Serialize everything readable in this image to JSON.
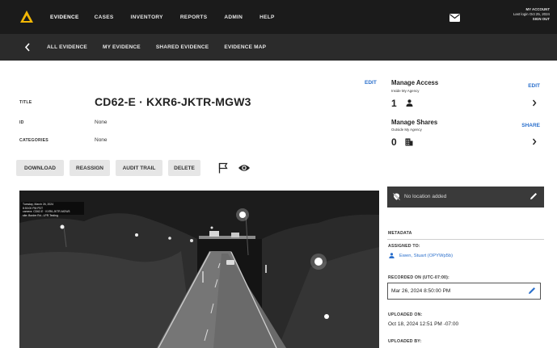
{
  "topnav": {
    "items": [
      "EVIDENCE",
      "CASES",
      "INVENTORY",
      "REPORTS",
      "ADMIN",
      "HELP"
    ],
    "active_index": 0,
    "account": {
      "title": "MY ACCOUNT",
      "last_login": "Last login Oct 25, 2024",
      "sign_out": "SIGN OUT"
    }
  },
  "subnav": {
    "items": [
      "ALL EVIDENCE",
      "MY EVIDENCE",
      "SHARED EVIDENCE",
      "EVIDENCE MAP"
    ]
  },
  "details": {
    "edit": "EDIT",
    "title_label": "TITLE",
    "title_value": "CD62-E · KXR6-JKTR-MGW3",
    "id_label": "ID",
    "id_value": "None",
    "categories_label": "CATEGORIES",
    "categories_value": "None"
  },
  "actions": [
    "DOWNLOAD",
    "REASSIGN",
    "AUDIT TRAIL",
    "DELETE"
  ],
  "access": {
    "title": "Manage Access",
    "subtitle": "Inside My Agency",
    "link": "EDIT",
    "count": "1"
  },
  "shares": {
    "title": "Manage Shares",
    "subtitle": "Outside My Agency",
    "link": "SHARE",
    "count": "0"
  },
  "video": {
    "overlay": [
      "Tuesday, March 26, 2024",
      "8:50:00 PM PDT",
      "camera: CD62-E · KXR6-JKTR-MGW3",
      "site: Border Rd - LPR Testing"
    ]
  },
  "location": {
    "text": "No location added"
  },
  "metadata": {
    "header": "METADATA",
    "assigned_label": "ASSIGNED TO:",
    "assigned_value": "Ewen, Stuart (OPYWp5b)",
    "recorded_label": "RECORDED ON (UTC-07:00):",
    "recorded_value": "Mar 26, 2024 8:50:00 PM",
    "uploaded_label": "UPLOADED ON:",
    "uploaded_value": "Oct 18, 2024 12:51 PM -07:00",
    "uploaded_by_label": "UPLOADED BY:"
  },
  "colors": {
    "topbar": "#1b1b1b",
    "subnav": "#2b2b2b",
    "accent_link": "#2a6fcc",
    "logo": "#f2b705"
  },
  "icons": [
    "logo-icon",
    "mail-icon",
    "back-chevron-icon",
    "flag-icon",
    "eye-icon",
    "person-icon",
    "building-icon",
    "chevron-right-icon",
    "location-off-icon",
    "pencil-icon"
  ]
}
